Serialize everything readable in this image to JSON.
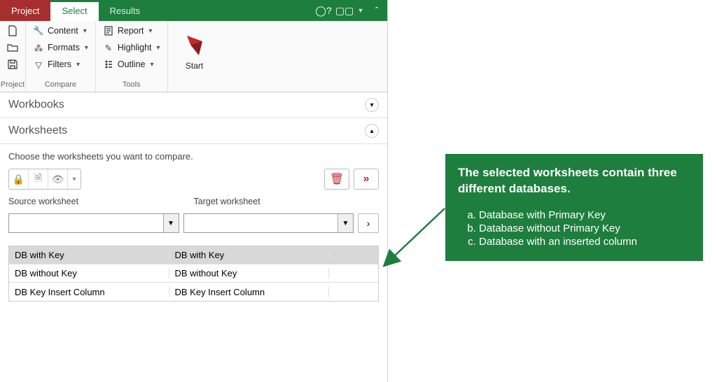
{
  "tabs": {
    "project": "Project",
    "select": "Select",
    "results": "Results"
  },
  "ribbon": {
    "groups": {
      "project": "Project",
      "compare": "Compare",
      "tools": "Tools"
    },
    "compare": {
      "content": "Content",
      "formats": "Formats",
      "filters": "Filters"
    },
    "tools": {
      "report": "Report",
      "highlight": "Highlight",
      "outline": "Outline"
    },
    "start": "Start"
  },
  "panels": {
    "workbooks": "Workbooks",
    "worksheets": "Worksheets"
  },
  "worksheets": {
    "instruction": "Choose the worksheets you want to compare.",
    "source_label": "Source worksheet",
    "target_label": "Target worksheet",
    "rows": [
      {
        "source": "DB with Key",
        "target": "DB with Key",
        "selected": true
      },
      {
        "source": "DB without Key",
        "target": "DB without Key",
        "selected": false
      },
      {
        "source": "DB Key Insert Column",
        "target": "DB Key Insert Column",
        "selected": false
      }
    ]
  },
  "callout": {
    "headline": "The selected worksheets contain three different databases.",
    "items": [
      "Database with Primary Key",
      "Database without Primary Key",
      "Database with an inserted column"
    ]
  }
}
